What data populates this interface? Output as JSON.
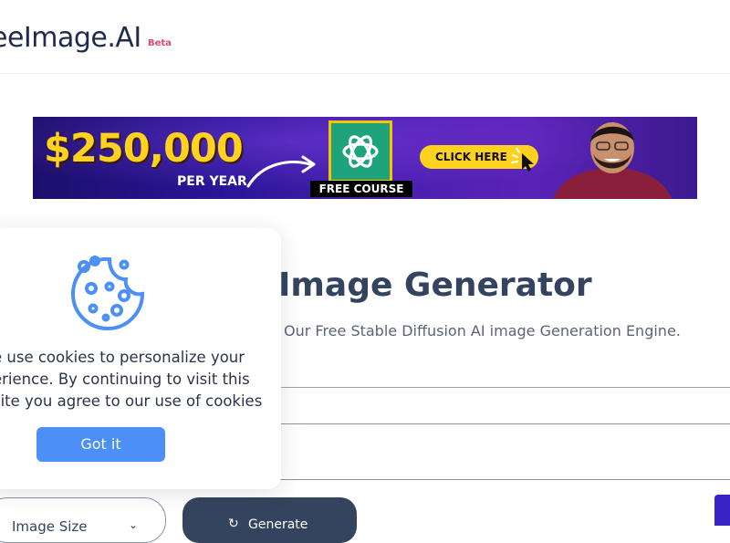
{
  "header": {
    "logo_text": "eeImage.AI",
    "beta_badge": "Beta"
  },
  "banner_ad": {
    "amount": "$250,000",
    "per_year": "PER YEAR",
    "badge": "FREE COURSE",
    "cta": "CLICK HERE"
  },
  "main": {
    "title": "Image Generator",
    "subtitle": "Our Free Stable Diffusion AI image Generation Engine.",
    "prompt_value": ""
  },
  "controls": {
    "size_select": "Image Size",
    "generate_label": "Generate",
    "generate_icon": "refresh-icon"
  },
  "cookie_banner": {
    "lines": [
      "e use cookies to personalize your",
      "erience. By continuing to visit this",
      "site you agree to our use of cookies"
    ],
    "button": "Got it"
  },
  "colors": {
    "primary": "#34435e",
    "accent_blue": "#4b8ff7",
    "beta_pink": "#e5447a",
    "banner_yellow": "#ffd21f"
  }
}
